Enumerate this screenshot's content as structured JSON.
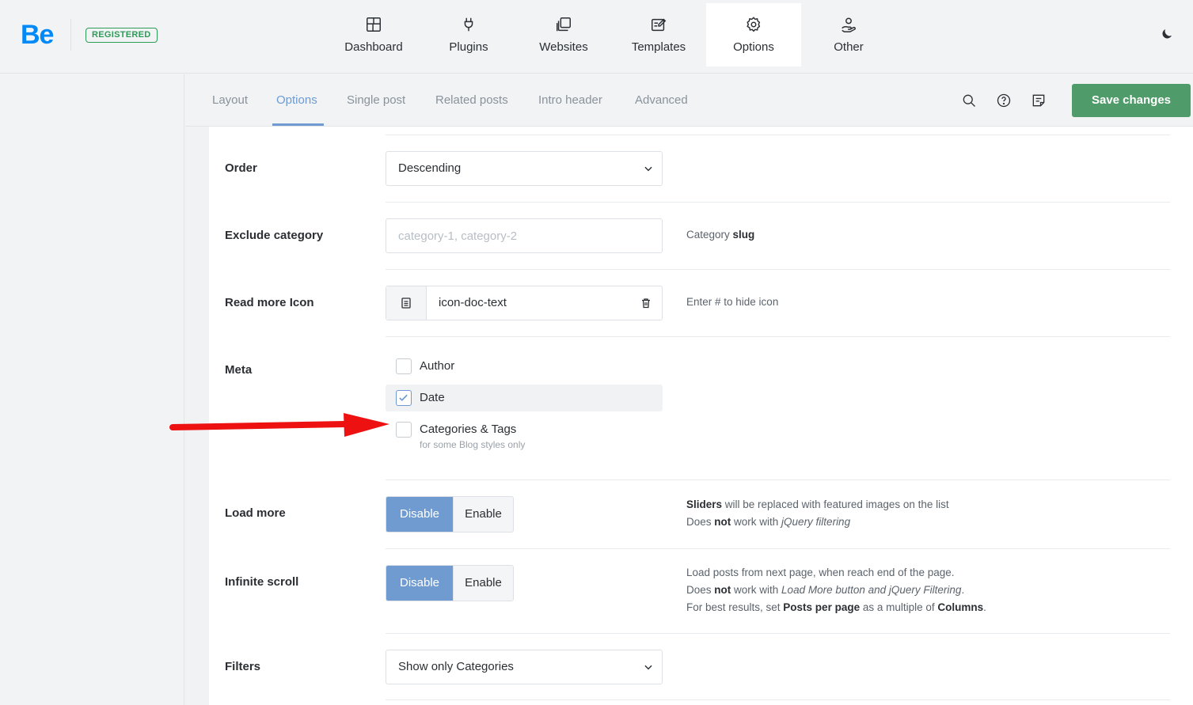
{
  "brand": {
    "logo_text": "Be",
    "badge": "REGISTERED"
  },
  "main_nav": [
    {
      "label": "Dashboard",
      "icon": "dashboard-icon"
    },
    {
      "label": "Plugins",
      "icon": "plug-icon"
    },
    {
      "label": "Websites",
      "icon": "websites-icon"
    },
    {
      "label": "Templates",
      "icon": "templates-icon"
    },
    {
      "label": "Options",
      "icon": "gear-icon",
      "active": true
    },
    {
      "label": "Other",
      "icon": "user-hand-icon"
    }
  ],
  "sub_tabs": [
    "Layout",
    "Options",
    "Single post",
    "Related posts",
    "Intro header",
    "Advanced"
  ],
  "active_sub_tab": "Options",
  "toolbar": {
    "save_label": "Save changes",
    "icons": [
      "search-icon",
      "help-icon",
      "notes-icon"
    ]
  },
  "colors": {
    "accent": "#6f9bd1",
    "save": "#4f9c6a",
    "brand": "#0089f7",
    "annotation_arrow": "#ee1111"
  },
  "fields": {
    "order": {
      "label": "Order",
      "value": "Descending"
    },
    "exclude_category": {
      "label": "Exclude category",
      "placeholder": "category-1, category-2",
      "desc_prefix": "Category",
      "desc_bold": "slug"
    },
    "read_more_icon": {
      "label": "Read more Icon",
      "value": "icon-doc-text",
      "desc": "Enter # to hide icon"
    },
    "meta": {
      "label": "Meta",
      "options": [
        {
          "label": "Author",
          "checked": false
        },
        {
          "label": "Date",
          "checked": true
        },
        {
          "label": "Categories & Tags",
          "checked": false
        }
      ],
      "categories_note": "for some Blog styles only"
    },
    "load_more": {
      "label": "Load more",
      "options": [
        "Disable",
        "Enable"
      ],
      "selected": "Disable",
      "desc1_bold": "Sliders",
      "desc1_rest": " will be replaced with featured images on the list",
      "desc2_a": "Does ",
      "desc2_bold": "not",
      "desc2_b": " work with ",
      "desc2_italic": "jQuery filtering"
    },
    "infinite_scroll": {
      "label": "Infinite scroll",
      "options": [
        "Disable",
        "Enable"
      ],
      "selected": "Disable",
      "desc1": "Load posts from next page, when reach end of the page.",
      "desc2_a": "Does ",
      "desc2_bold": "not",
      "desc2_b": " work with ",
      "desc2_italic": "Load More button and jQuery Filtering",
      "desc2_end": ".",
      "desc3_a": "For best results, set ",
      "desc3_bold1": "Posts per page",
      "desc3_b": " as a multiple of ",
      "desc3_bold2": "Columns",
      "desc3_end": "."
    },
    "filters": {
      "label": "Filters",
      "value": "Show only Categories"
    }
  }
}
